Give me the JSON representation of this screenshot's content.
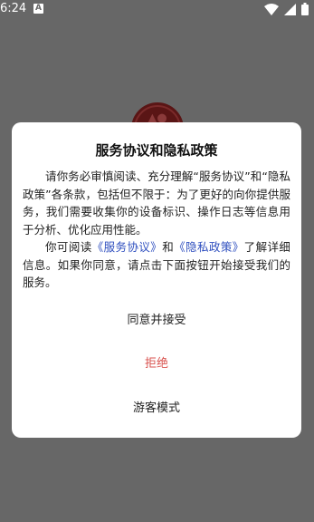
{
  "status_bar": {
    "time": "6:24",
    "notification_icon": "A"
  },
  "dialog": {
    "title": "服务协议和隐私政策",
    "paragraph1": "请你务必审慎阅读、充分理解“服务协议”和“隐私政策”各条款，包括但不限于：为了更好的向你提供服务，我们需要收集你的设备标识、操作日志等信息用于分析、优化应用性能。",
    "paragraph2_prefix": "你可阅读",
    "service_link": "《服务协议》",
    "paragraph2_and": "和",
    "privacy_link": "《隐私政策》",
    "paragraph2_suffix": "了解详细信息。如果你同意，请点击下面按钮开始接受我们的服务。",
    "accept_label": "同意并接受",
    "reject_label": "拒绝",
    "guest_label": "游客模式"
  },
  "colors": {
    "overlay": "#676767",
    "link": "#2f4fbf",
    "reject": "#d9534f"
  }
}
